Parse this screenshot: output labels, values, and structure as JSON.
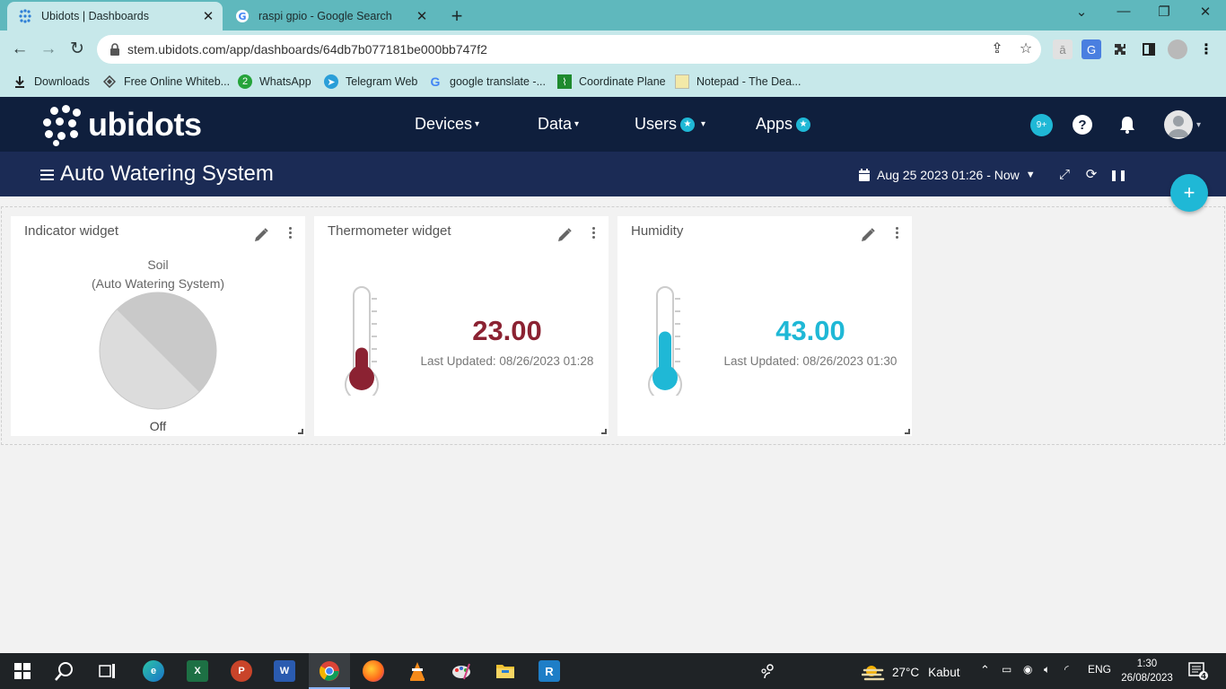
{
  "browser": {
    "tabs": [
      {
        "title": "Ubidots | Dashboards",
        "active": true
      },
      {
        "title": "raspi gpio - Google Search",
        "active": false
      }
    ],
    "url": "stem.ubidots.com/app/dashboards/64db7b077181be000bb747f2",
    "bookmarks": [
      {
        "label": "Downloads",
        "icon": "download-icon"
      },
      {
        "label": "Free Online Whiteb...",
        "icon": "whiteboard-icon"
      },
      {
        "label": "WhatsApp",
        "icon": "whatsapp-icon",
        "badge": "2"
      },
      {
        "label": "Telegram Web",
        "icon": "telegram-icon"
      },
      {
        "label": "google translate -...",
        "icon": "google-icon"
      },
      {
        "label": "Coordinate Plane",
        "icon": "coordinate-plane-icon"
      },
      {
        "label": "Notepad - The Dea...",
        "icon": "notepad-icon"
      }
    ]
  },
  "header": {
    "brand": "ubidots",
    "nav": [
      {
        "label": "Devices",
        "star": false,
        "caret": true
      },
      {
        "label": "Data",
        "star": false,
        "caret": true
      },
      {
        "label": "Users",
        "star": true,
        "caret": true
      },
      {
        "label": "Apps",
        "star": true,
        "caret": false
      }
    ],
    "notifications_badge": "9+",
    "help_label": "?"
  },
  "dashboard": {
    "title": "Auto Watering System",
    "date_range": "Aug 25 2023 01:26 - Now",
    "add_label": "+"
  },
  "widgets": {
    "indicator": {
      "title": "Indicator widget",
      "variable": "Soil",
      "device": "(Auto Watering System)",
      "state": "Off",
      "color": "#d9d9d9"
    },
    "thermometer": {
      "title": "Thermometer widget",
      "value": "23.00",
      "fill_fraction": 0.35,
      "last_updated": "Last Updated: 08/26/2023 01:28",
      "color": "#8b2232"
    },
    "humidity": {
      "title": "Humidity",
      "value": "43.00",
      "fill_fraction": 0.55,
      "last_updated": "Last Updated: 08/26/2023 01:30",
      "color": "#1fb8d6"
    }
  },
  "taskbar": {
    "weather_temp": "27°C",
    "weather_text": "Kabut",
    "language": "ENG",
    "time": "1:30",
    "date": "26/08/2023",
    "notification_count": "4",
    "apps": [
      "windows-start-icon",
      "search-icon",
      "task-view-icon",
      "edge-icon",
      "excel-icon",
      "powerpoint-icon",
      "word-icon",
      "chrome-icon",
      "firefox-icon",
      "vlc-icon",
      "paint-icon",
      "file-explorer-icon",
      "rstudio-icon"
    ]
  }
}
